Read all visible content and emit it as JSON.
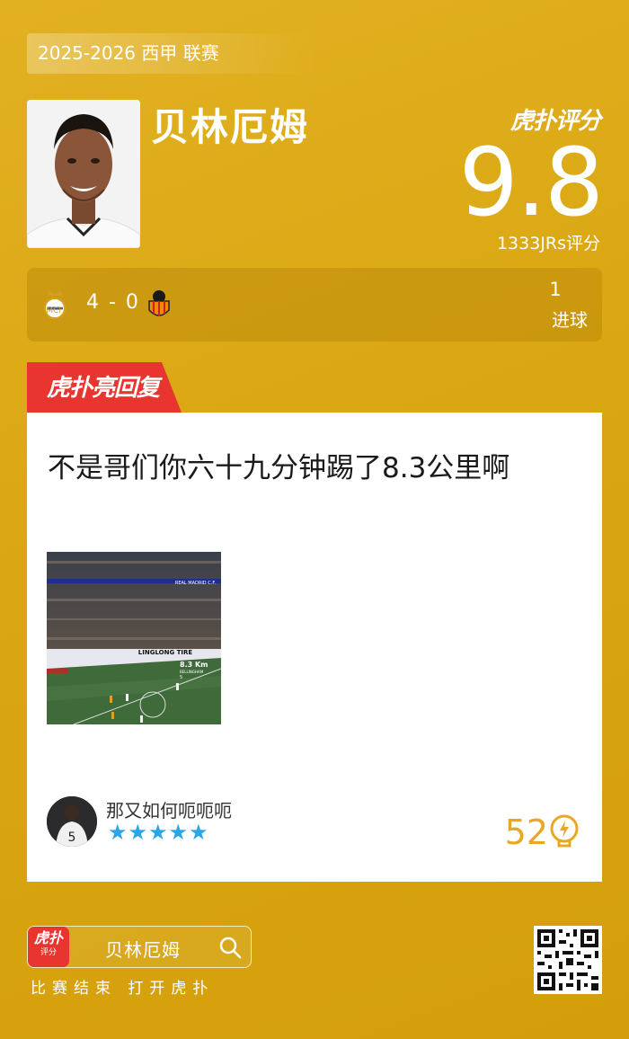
{
  "header": {
    "season_label": "2025-2026 西甲 联赛",
    "player_name": "贝林厄姆",
    "brand": "虎扑评分",
    "score": "9.8",
    "rating_count": "1333JRs评分"
  },
  "match": {
    "home_team_icon": "real-madrid-crest-icon",
    "away_team_icon": "valencia-crest-icon",
    "score": "4 - 0",
    "stat_value": "1",
    "stat_label": "进球"
  },
  "highlight_tag": "虎扑亮回复",
  "comment": {
    "text": "不是哥们你六十九分钟踢了8.3公里啊",
    "clip_overlay_distance": "8.3 Km",
    "clip_overlay_name": "BELLINGHAM",
    "clip_overlay_number": "5",
    "clip_banner": "LINGLONG TIRE",
    "clip_club": "REAL MADRID C.F.",
    "username": "那又如何呃呃呃",
    "stars": "★★★★★",
    "star_count": 5,
    "likes": "52"
  },
  "footer": {
    "app_icon_text": "虎扑",
    "app_icon_sub": "评分",
    "search_text": "贝林厄姆",
    "caption": "比赛结束 打开虎扑"
  },
  "colors": {
    "background": "#daa712",
    "accent_red": "#e8352f",
    "star_blue": "#2aa6e8",
    "like_orange": "#e7a823"
  }
}
